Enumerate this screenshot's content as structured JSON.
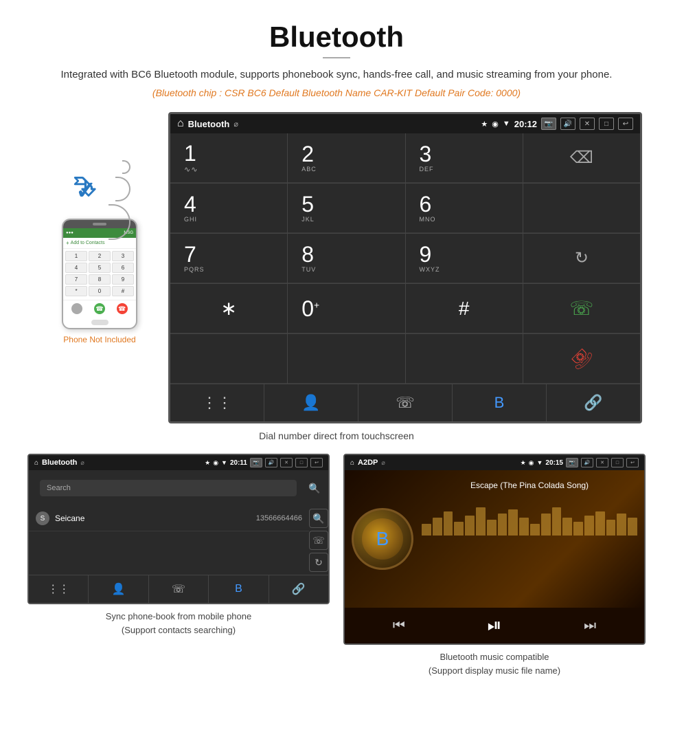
{
  "page": {
    "title": "Bluetooth",
    "subtitle": "Integrated with BC6 Bluetooth module, supports phonebook sync, hands-free call, and music streaming from your phone.",
    "chip_info": "(Bluetooth chip : CSR BC6    Default Bluetooth Name CAR-KIT    Default Pair Code: 0000)"
  },
  "dialpad_screen": {
    "status_bar": {
      "title": "Bluetooth",
      "usb_icon": "⌀",
      "time": "20:12",
      "icons": [
        "📷",
        "🔊",
        "✕",
        "⬜",
        "↩"
      ]
    },
    "keys": [
      {
        "number": "1",
        "letters": "∿∿"
      },
      {
        "number": "2",
        "letters": "ABC"
      },
      {
        "number": "3",
        "letters": "DEF"
      },
      {
        "number": "",
        "letters": "",
        "special": "backspace"
      },
      {
        "number": "4",
        "letters": "GHI"
      },
      {
        "number": "5",
        "letters": "JKL"
      },
      {
        "number": "6",
        "letters": "MNO"
      },
      {
        "number": "",
        "letters": "",
        "special": "empty"
      },
      {
        "number": "7",
        "letters": "PQRS"
      },
      {
        "number": "8",
        "letters": "TUV"
      },
      {
        "number": "9",
        "letters": "WXYZ"
      },
      {
        "number": "",
        "letters": "",
        "special": "reload"
      },
      {
        "number": "*",
        "letters": ""
      },
      {
        "number": "0",
        "letters": "+",
        "super": true
      },
      {
        "number": "#",
        "letters": ""
      },
      {
        "number": "",
        "letters": "",
        "special": "call_green"
      },
      {
        "number": "",
        "letters": "",
        "special": "empty"
      },
      {
        "number": "",
        "letters": "",
        "special": "call_red"
      }
    ],
    "action_bar": [
      "grid",
      "person",
      "phone",
      "bluetooth",
      "link"
    ],
    "caption": "Dial number direct from touchscreen"
  },
  "phonebook_screen": {
    "status_bar": {
      "title": "Bluetooth",
      "time": "20:11"
    },
    "search_placeholder": "Search",
    "contacts": [
      {
        "letter": "S",
        "name": "Seicane",
        "number": "13566664466"
      }
    ],
    "caption_line1": "Sync phone-book from mobile phone",
    "caption_line2": "(Support contacts searching)"
  },
  "music_screen": {
    "status_bar": {
      "title": "A2DP",
      "time": "20:15"
    },
    "song_title": "Escape (The Pina Colada Song)",
    "eq_bars": [
      30,
      45,
      60,
      35,
      50,
      70,
      40,
      55,
      65,
      45,
      30,
      55,
      70,
      45,
      35,
      50,
      60,
      40,
      55,
      45
    ],
    "controls": [
      "prev",
      "play_pause",
      "next"
    ],
    "caption_line1": "Bluetooth music compatible",
    "caption_line2": "(Support display music file name)"
  },
  "phone_mockup": {
    "not_included": "Phone Not Included"
  }
}
